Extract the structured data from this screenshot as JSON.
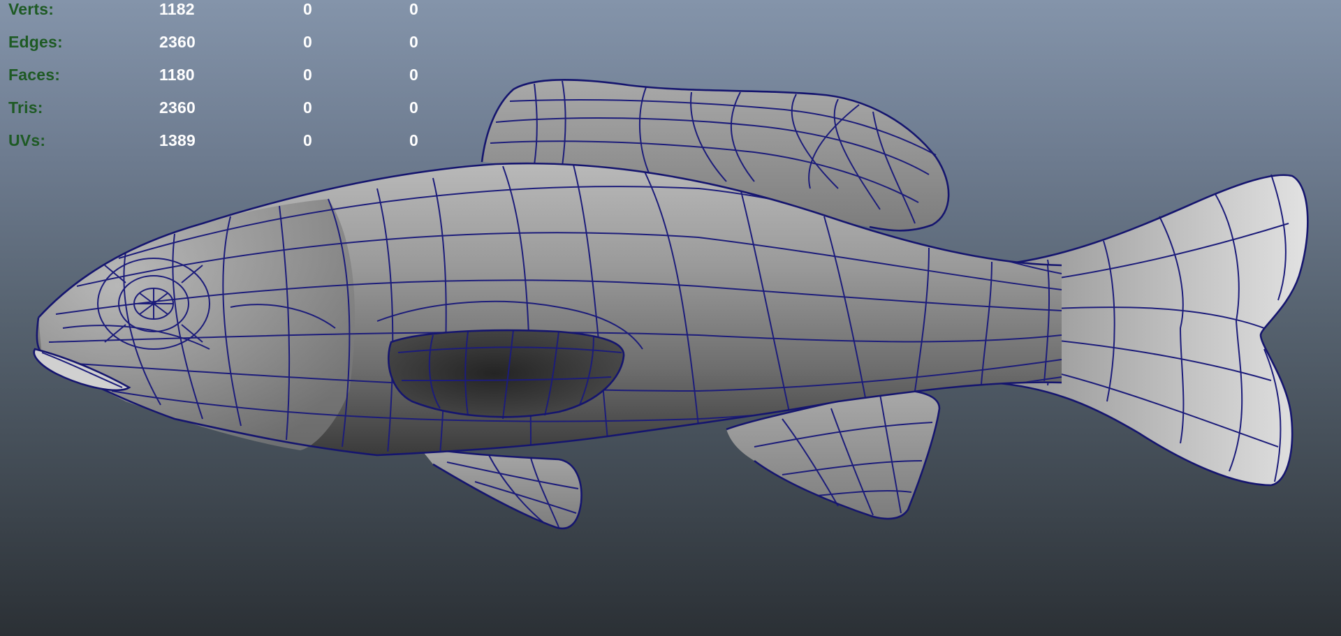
{
  "viewport": {
    "background_top": "#8494aa",
    "background_bottom": "#2b3035",
    "wireframe_color": "#1c1c7a",
    "label_color": "#1e5a24",
    "value_color": "#ffffff"
  },
  "poly_count_hud": {
    "rows": [
      {
        "label": "Verts:",
        "values": [
          "1182",
          "0",
          "0"
        ]
      },
      {
        "label": "Edges:",
        "values": [
          "2360",
          "0",
          "0"
        ]
      },
      {
        "label": "Faces:",
        "values": [
          "1180",
          "0",
          "0"
        ]
      },
      {
        "label": "Tris:",
        "values": [
          "2360",
          "0",
          "0"
        ]
      },
      {
        "label": "UVs:",
        "values": [
          "1389",
          "0",
          "0"
        ]
      }
    ]
  }
}
